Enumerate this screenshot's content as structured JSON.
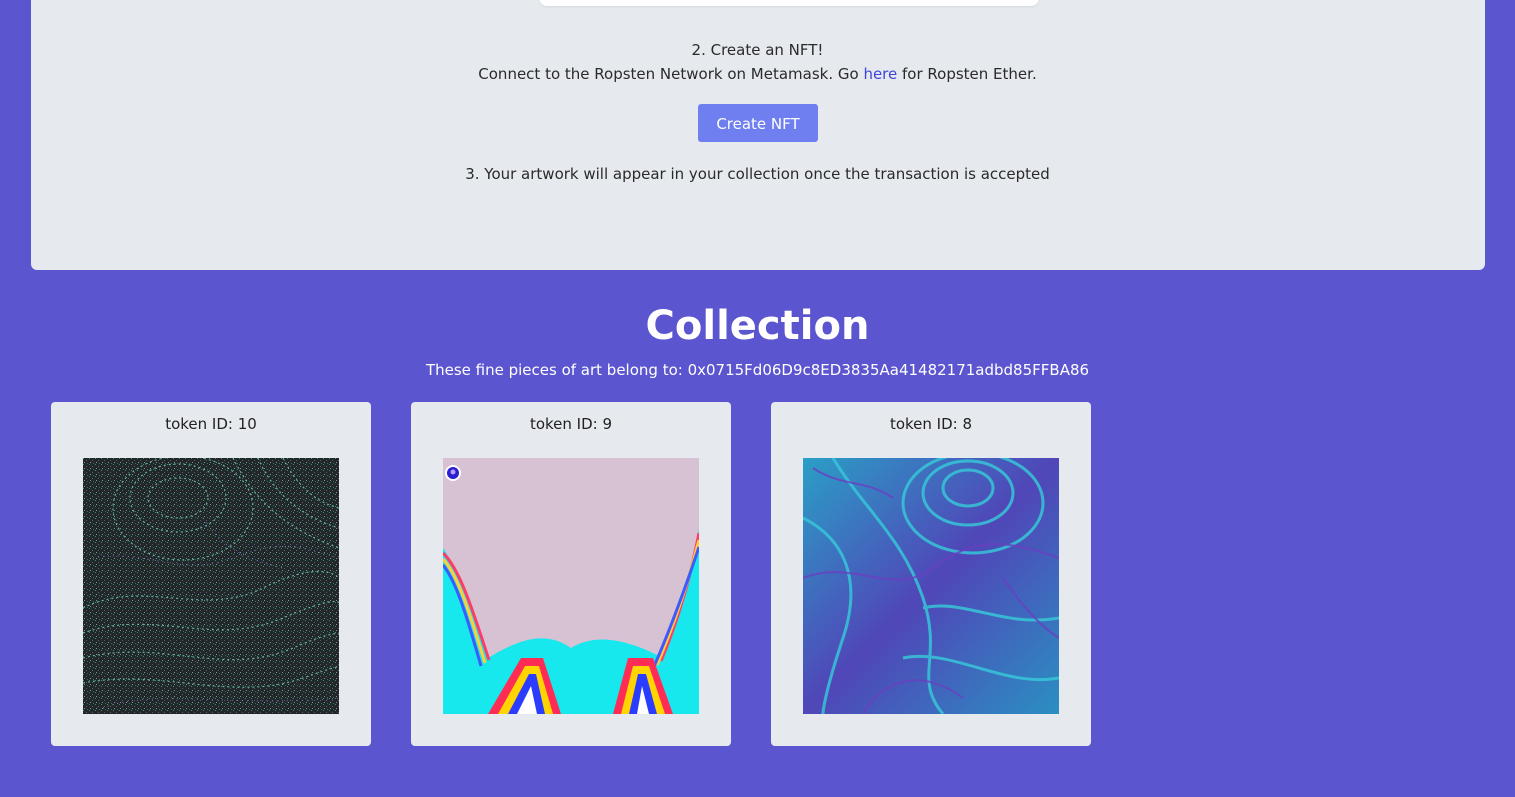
{
  "steps": {
    "step2_title": "2. Create an NFT!",
    "step2_prefix": "Connect to the Ropsten Network on Metamask. Go ",
    "step2_link": "here",
    "step2_suffix": " for Ropsten Ether.",
    "create_button": "Create NFT",
    "step3": "3. Your artwork will appear in your collection once the transaction is accepted"
  },
  "collection": {
    "title": "Collection",
    "owner_line": "These fine pieces of art belong to: 0x0715Fd06D9c8ED3835Aa41482171adbd85FFBA86",
    "tokens": [
      {
        "label": "token ID: 10"
      },
      {
        "label": "token ID: 9"
      },
      {
        "label": "token ID: 8"
      }
    ]
  },
  "colors": {
    "background": "#5b55cf",
    "panel": "#e6eaee",
    "button": "#6f7ff0",
    "link": "#3e45d8"
  }
}
